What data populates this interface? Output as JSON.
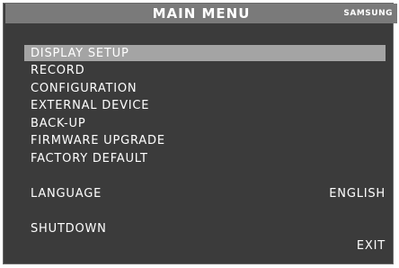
{
  "header": {
    "title": "MAIN MENU",
    "brand": "SAMSUNG"
  },
  "menu": {
    "items": [
      {
        "label": "DISPLAY SETUP",
        "selected": true
      },
      {
        "label": "RECORD"
      },
      {
        "label": "CONFIGURATION"
      },
      {
        "label": "EXTERNAL DEVICE"
      },
      {
        "label": "BACK-UP"
      },
      {
        "label": "FIRMWARE UPGRADE"
      },
      {
        "label": "FACTORY DEFAULT"
      }
    ]
  },
  "language": {
    "label": "LANGUAGE",
    "value": "ENGLISH"
  },
  "shutdown": {
    "label": "SHUTDOWN"
  },
  "exit": {
    "label": "EXIT"
  },
  "colors": {
    "background": "#3b3b3b",
    "titlebar": "#7a7a7a",
    "highlight": "#a4a4a4",
    "text": "#ffffff"
  }
}
